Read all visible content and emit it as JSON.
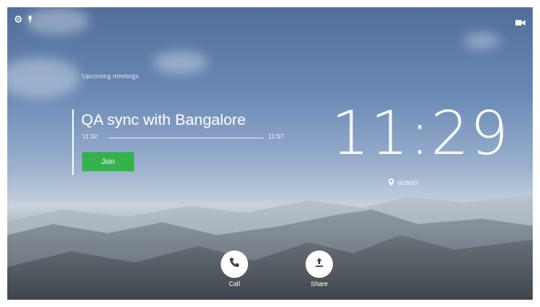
{
  "upcoming": {
    "section_label": "Upcoming meetings"
  },
  "meeting": {
    "title": "QA sync with Bangalore",
    "start_time": "11:32",
    "end_time": "11:57",
    "join_label": "Join"
  },
  "clock": {
    "time": "11:29"
  },
  "location": {
    "label": "acano"
  },
  "actions": [
    {
      "label": "Call",
      "icon": "phone-icon"
    },
    {
      "label": "Share",
      "icon": "share-icon"
    }
  ],
  "icons": {
    "top_left": [
      "settings-icon",
      "microphone-icon"
    ],
    "top_right": "camera-icon"
  },
  "colors": {
    "join_button": "#34b34a"
  }
}
